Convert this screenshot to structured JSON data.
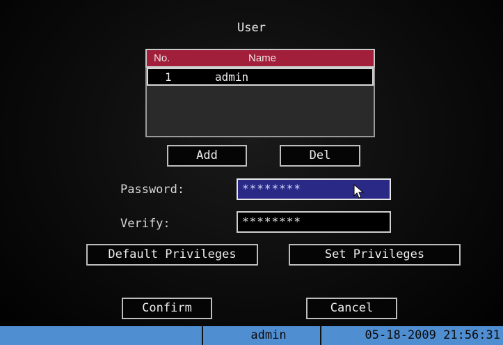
{
  "window": {
    "title": "User"
  },
  "user_list": {
    "columns": {
      "no": "No.",
      "name": "Name"
    },
    "rows": [
      {
        "no": "1",
        "name": "admin"
      }
    ]
  },
  "buttons": {
    "add": "Add",
    "del": "Del",
    "default_privileges": "Default Privileges",
    "set_privileges": "Set Privileges",
    "confirm": "Confirm",
    "cancel": "Cancel"
  },
  "password": {
    "label": "Password:",
    "value": "********"
  },
  "verify": {
    "label": "Verify:",
    "value": "********"
  },
  "status_bar": {
    "user": "admin",
    "datetime": "05-18-2009 21:56:31"
  },
  "colors": {
    "header_bg": "#a11f3a",
    "active_field_bg": "#2a2a86",
    "status_bar_bg": "#4f8ed1"
  },
  "icons": {
    "pointer": "mouse-pointer-icon"
  }
}
